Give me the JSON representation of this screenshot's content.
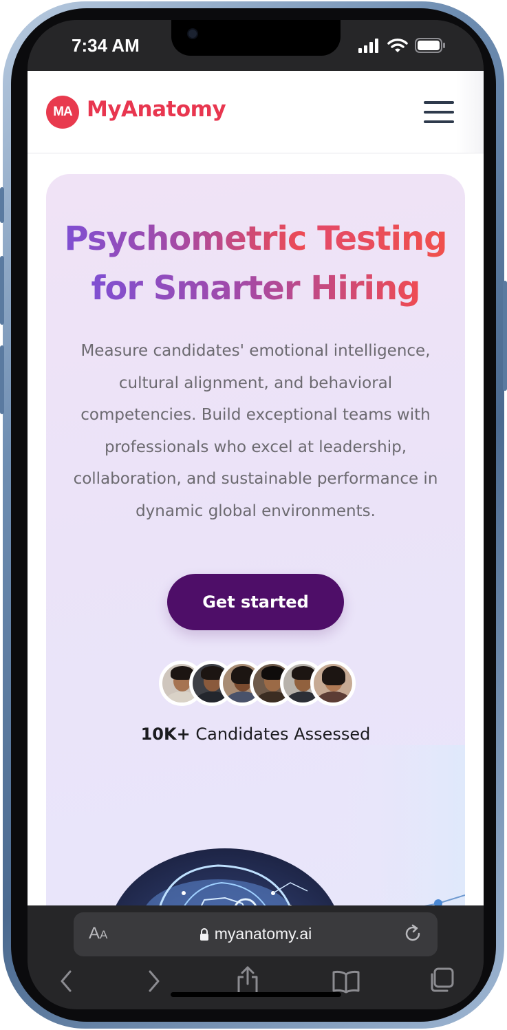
{
  "status_bar": {
    "time": "7:34 AM"
  },
  "site": {
    "logo_text": "MA",
    "brand": "MyAnatomy",
    "hero": {
      "title_line1_a": "Psychometric",
      "title_line1_b": "Testing",
      "title_line2": "for Smarter Hiring",
      "description": "Measure candidates' emotional intelligence, cultural alignment, and behavioral competencies. Build exceptional teams with professionals who excel at leadership, collaboration, and sustainable performance in dynamic global environments.",
      "cta_label": "Get started",
      "stat_number": "10K+",
      "stat_label": "Candidates Assessed"
    }
  },
  "browser": {
    "aa_label_big": "A",
    "aa_label_small": "A",
    "url": "myanatomy.ai"
  },
  "colors": {
    "brand_red": "#e8364f",
    "cta_purple": "#4e0e68",
    "gradient_start": "#7f4fd2",
    "gradient_end": "#ef4b52"
  }
}
